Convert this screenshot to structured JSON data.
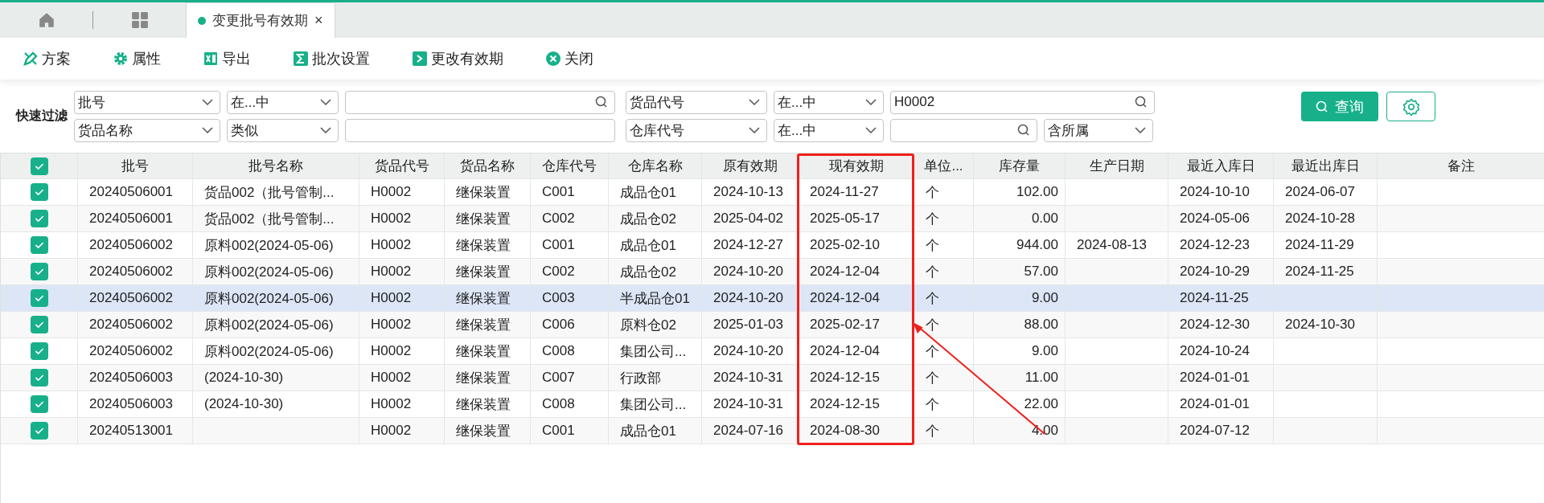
{
  "tabs": [
    {
      "label": "变更批号有效期",
      "close": "×",
      "selected": true
    }
  ],
  "toolbar": [
    {
      "kind": "plan",
      "label": "方案"
    },
    {
      "kind": "gear",
      "label": "属性"
    },
    {
      "kind": "excel",
      "label": "导出"
    },
    {
      "kind": "sigma",
      "label": "批次设置"
    },
    {
      "kind": "prompt",
      "label": "更改有效期"
    },
    {
      "kind": "close",
      "label": "关闭"
    }
  ],
  "filter": {
    "label": "快速过滤",
    "groups": [
      {
        "rows": [
          [
            {
              "kind": "select",
              "value": "批号"
            },
            {
              "kind": "select",
              "value": "在...中"
            },
            {
              "kind": "search"
            }
          ],
          [
            {
              "kind": "select",
              "value": "货品名称"
            },
            {
              "kind": "select",
              "value": "类似"
            },
            {
              "kind": "text"
            }
          ]
        ]
      },
      {
        "rows": [
          [
            {
              "kind": "select",
              "value": "货品代号"
            },
            {
              "kind": "select",
              "value": "在...中"
            },
            {
              "kind": "search",
              "value": "H0002"
            }
          ],
          [
            {
              "kind": "select",
              "value": "仓库代号"
            },
            {
              "kind": "select",
              "value": "在...中"
            },
            {
              "kind": "search"
            },
            {
              "kind": "select",
              "value": "含所属"
            }
          ]
        ]
      }
    ],
    "query_button": "查询"
  },
  "table": {
    "all_checked": true,
    "columns": [
      {
        "label": "批号",
        "highlighted": false
      },
      {
        "label": "批号名称",
        "highlighted": false
      },
      {
        "label": "货品代号",
        "highlighted": false
      },
      {
        "label": "货品名称",
        "highlighted": false
      },
      {
        "label": "仓库代号",
        "highlighted": false
      },
      {
        "label": "仓库名称",
        "highlighted": false
      },
      {
        "label": "原有效期",
        "highlighted": false
      },
      {
        "label": "现有效期",
        "highlighted": true
      },
      {
        "label": "单位...",
        "highlighted": false
      },
      {
        "label": "库存量",
        "highlighted": false
      },
      {
        "label": "生产日期",
        "highlighted": false
      },
      {
        "label": "最近入库日",
        "highlighted": false
      },
      {
        "label": "最近出库日",
        "highlighted": false
      },
      {
        "label": "备注",
        "highlighted": false
      }
    ],
    "rows": [
      {
        "checked": true,
        "hover": false,
        "cells": [
          "20240506001",
          "货品002（批号管制...",
          "H0002",
          "继保装置",
          "C001",
          "成品仓01",
          "2024-10-13",
          "2024-11-27",
          "个",
          "102.00",
          null,
          "2024-10-10",
          "2024-06-07",
          null
        ]
      },
      {
        "checked": true,
        "hover": false,
        "cells": [
          "20240506001",
          "货品002（批号管制...",
          "H0002",
          "继保装置",
          "C002",
          "成品仓02",
          "2025-04-02",
          "2025-05-17",
          "个",
          "0.00",
          null,
          "2024-05-06",
          "2024-10-28",
          null
        ]
      },
      {
        "checked": true,
        "hover": false,
        "cells": [
          "20240506002",
          "原料002(2024-05-06)",
          "H0002",
          "继保装置",
          "C001",
          "成品仓01",
          "2024-12-27",
          "2025-02-10",
          "个",
          "944.00",
          "2024-08-13",
          "2024-12-23",
          "2024-11-29",
          null
        ]
      },
      {
        "checked": true,
        "hover": false,
        "cells": [
          "20240506002",
          "原料002(2024-05-06)",
          "H0002",
          "继保装置",
          "C002",
          "成品仓02",
          "2024-10-20",
          "2024-12-04",
          "个",
          "57.00",
          null,
          "2024-10-29",
          "2024-11-25",
          null
        ]
      },
      {
        "checked": true,
        "hover": true,
        "cells": [
          "20240506002",
          "原料002(2024-05-06)",
          "H0002",
          "继保装置",
          "C003",
          "半成品仓01",
          "2024-10-20",
          "2024-12-04",
          "个",
          "9.00",
          null,
          "2024-11-25",
          null,
          null
        ]
      },
      {
        "checked": true,
        "hover": false,
        "cells": [
          "20240506002",
          "原料002(2024-05-06)",
          "H0002",
          "继保装置",
          "C006",
          "原料仓02",
          "2025-01-03",
          "2025-02-17",
          "个",
          "88.00",
          null,
          "2024-12-30",
          "2024-10-30",
          null
        ]
      },
      {
        "checked": true,
        "hover": false,
        "cells": [
          "20240506002",
          "原料002(2024-05-06)",
          "H0002",
          "继保装置",
          "C008",
          "集团公司...",
          "2024-10-20",
          "2024-12-04",
          "个",
          "9.00",
          null,
          "2024-10-24",
          null,
          null
        ]
      },
      {
        "checked": true,
        "hover": false,
        "cells": [
          "20240506003",
          "(2024-10-30)",
          "H0002",
          "继保装置",
          "C007",
          "行政部",
          "2024-10-31",
          "2024-12-15",
          "个",
          "11.00",
          null,
          "2024-01-01",
          null,
          null
        ]
      },
      {
        "checked": true,
        "hover": false,
        "cells": [
          "20240506003",
          "(2024-10-30)",
          "H0002",
          "继保装置",
          "C008",
          "集团公司...",
          "2024-10-31",
          "2024-12-15",
          "个",
          "22.00",
          null,
          "2024-01-01",
          null,
          null
        ]
      },
      {
        "checked": true,
        "hover": false,
        "cells": [
          "20240513001",
          null,
          "H0002",
          "继保装置",
          "C001",
          "成品仓01",
          "2024-07-16",
          "2024-08-30",
          "个",
          "4.00",
          null,
          "2024-07-12",
          null,
          null
        ]
      }
    ]
  }
}
